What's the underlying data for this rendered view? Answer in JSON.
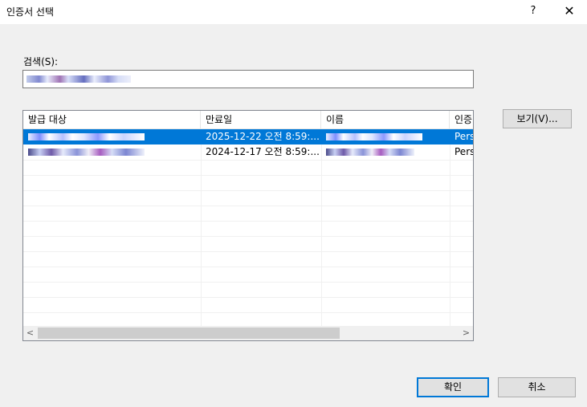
{
  "window": {
    "title": "인증서 선택",
    "help_label": "?",
    "close_label": "✕"
  },
  "search": {
    "label": "검색(S):",
    "value_obscured": true
  },
  "table": {
    "columns": [
      "발급 대상",
      "만료일",
      "이름",
      "인증"
    ],
    "rows": [
      {
        "issued_to_obscured": true,
        "expires": "2025-12-22 오전 8:59:...",
        "name_obscured": true,
        "purpose": "Pers",
        "selected": true
      },
      {
        "issued_to_obscured": true,
        "expires": "2024-12-17 오전 8:59:...",
        "name_obscured": true,
        "purpose": "Pers",
        "selected": false
      }
    ],
    "scroll_left": "<",
    "scroll_right": ">"
  },
  "buttons": {
    "view": "보기(V)...",
    "ok": "확인",
    "cancel": "취소"
  },
  "colors": {
    "selection": "#0078d7",
    "dialog_bg": "#f0f0f0"
  }
}
